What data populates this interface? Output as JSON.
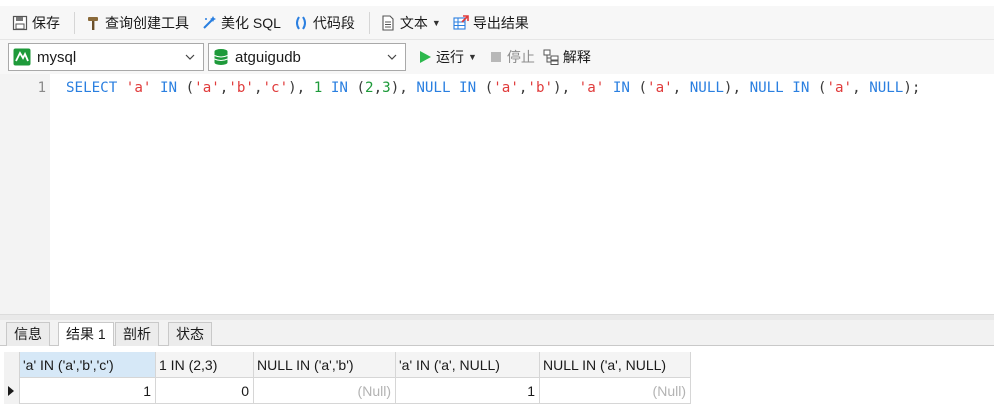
{
  "toolbar": {
    "save": "保存",
    "query_builder": "查询创建工具",
    "beautify": "美化 SQL",
    "snippet": "代码段",
    "text": "文本",
    "export": "导出结果"
  },
  "connection": {
    "conn_value": "mysql",
    "db_value": "atguigudb",
    "run": "运行",
    "stop": "停止",
    "explain": "解释"
  },
  "editor": {
    "line_number": "1",
    "sql": "SELECT 'a' IN ('a','b','c'), 1 IN (2,3), NULL IN ('a','b'), 'a' IN ('a', NULL), NULL IN ('a', NULL);"
  },
  "tabs": [
    {
      "label": "信息"
    },
    {
      "label": "结果 1",
      "active": true
    },
    {
      "label": "剖析"
    },
    {
      "label": "状态"
    }
  ],
  "result": {
    "columns": [
      "'a' IN ('a','b','c')",
      "1 IN (2,3)",
      "NULL IN ('a','b')",
      "'a' IN ('a', NULL)",
      "NULL IN ('a', NULL)"
    ],
    "rows": [
      [
        "1",
        "0",
        "(Null)",
        "1",
        "(Null)"
      ]
    ]
  },
  "colors": {
    "keyword": "#2a7fe0",
    "string": "#e03b3b",
    "number": "#1e9a3a",
    "run_green": "#2db84d",
    "selected_header": "#d6e8f7"
  },
  "icons": [
    "save-icon",
    "hammer-icon",
    "magic-wand-icon",
    "parentheses-icon",
    "document-icon",
    "export-icon",
    "mysql-connection-icon",
    "database-icon",
    "play-icon",
    "stop-icon",
    "explain-icon"
  ]
}
